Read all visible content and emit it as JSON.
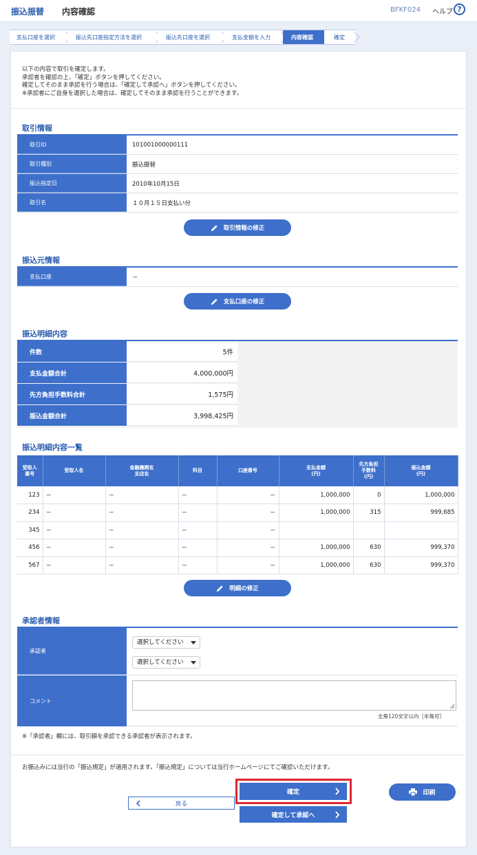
{
  "header": {
    "title": "振込振替",
    "subtitle": "内容確認",
    "screen_code": "BFKF024",
    "help_label": "ヘルプ",
    "help_icon": "?"
  },
  "steps": [
    {
      "label": "支払口座を選択"
    },
    {
      "label": "振込先口座指定方法を選択"
    },
    {
      "label": "振込先口座を選択"
    },
    {
      "label": "支払金額を入力"
    },
    {
      "label": "内容確認"
    },
    {
      "label": "確定"
    }
  ],
  "intro": {
    "line1": "以下の内容で取引を確定します。",
    "line2": "承認者を確認の上、「確定」ボタンを押してください。",
    "line3": "確定してそのまま承認を行う場合は、「確定して承認へ」ボタンを押してください。",
    "line4": "※承認者にご自身を選択した場合は、確定してそのまま承認を行うことができます。"
  },
  "transaction": {
    "title": "取引情報",
    "rows": [
      {
        "label": "取引ID",
        "value": "101001000000111"
      },
      {
        "label": "取引種別",
        "value": "振込振替"
      },
      {
        "label": "振込指定日",
        "value": "2010年10月15日"
      },
      {
        "label": "取引名",
        "value": "１０月１５日支払い分"
      }
    ],
    "edit_button": "取引情報の修正"
  },
  "source": {
    "title": "振込元情報",
    "rows": [
      {
        "label": "支払口座",
        "value": "－"
      }
    ],
    "edit_button": "支払口座の修正"
  },
  "summary": {
    "title": "振込明細内容",
    "rows": [
      {
        "label": "件数",
        "value": "5件"
      },
      {
        "label": "支払金額合計",
        "value": "4,000,000円"
      },
      {
        "label": "先方負担手数料合計",
        "value": "1,575円"
      },
      {
        "label": "振込金額合計",
        "value": "3,998,425円"
      }
    ]
  },
  "details": {
    "title": "振込明細内容一覧",
    "columns": [
      "受取人\n番号",
      "受取人名",
      "金融機関名\n支店名",
      "科目",
      "口座番号",
      "支払金額\n(円)",
      "先方負担\n手数料\n(円)",
      "振込金額\n(円)"
    ],
    "rows": [
      [
        "123",
        "－",
        "－",
        "－",
        "－",
        "1,000,000",
        "0",
        "1,000,000"
      ],
      [
        "234",
        "－",
        "－",
        "－",
        "－",
        "1,000,000",
        "315",
        "999,685"
      ],
      [
        "345",
        "－",
        "－",
        "－",
        "－",
        "",
        "",
        ""
      ],
      [
        "456",
        "－",
        "－",
        "－",
        "－",
        "1,000,000",
        "630",
        "999,370"
      ],
      [
        "567",
        "－",
        "－",
        "－",
        "－",
        "1,000,000",
        "630",
        "999,370"
      ]
    ],
    "edit_button": "明細の修正"
  },
  "approver": {
    "title": "承認者情報",
    "approver_label": "承認者",
    "select1": "選択してください",
    "select2": "選択してください",
    "comment_label": "コメント",
    "comment_hint": "全角120文字以内［半角可］",
    "note": "※「承認者」欄には、取引額を承認できる承認者が表示されます。"
  },
  "footer": {
    "notice": "お振込みには当行の「振込規定」が適用されます。「振込規定」については当行ホームページにてご確認いただけます。",
    "back_button": "戻る",
    "confirm_button": "確定",
    "confirm_approve_button": "確定して承認へ",
    "print_button": "印刷"
  },
  "colors": {
    "primary": "#3d6fcb",
    "highlight": "#e0262d",
    "page_bg": "#e9eef7"
  }
}
